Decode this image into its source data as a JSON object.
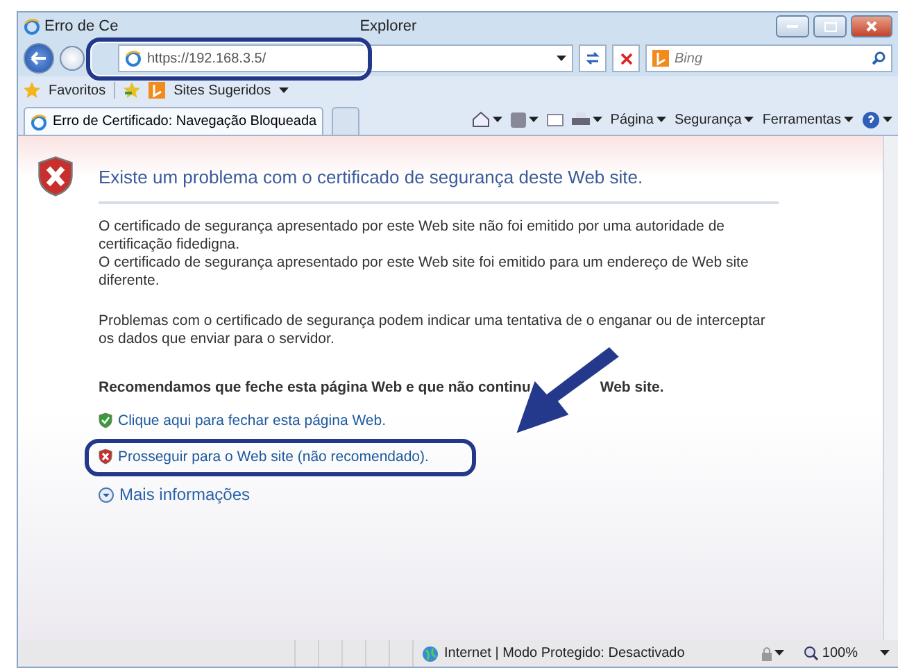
{
  "window": {
    "title_start": "Erro de Ce",
    "title_end": "Explorer"
  },
  "address_bar": {
    "url": "https://192.168.3.5/"
  },
  "search": {
    "placeholder": "Bing"
  },
  "favorites_bar": {
    "favorites": "Favoritos",
    "suggested": "Sites Sugeridos"
  },
  "tabs": [
    {
      "label": "Erro de Certificado: Navegação Bloqueada",
      "selected": true
    }
  ],
  "command_bar": [
    "Página",
    "Segurança",
    "Ferramentas"
  ],
  "content": {
    "heading": "Existe um problema com o certificado de segurança deste Web site.",
    "paragraphs": [
      "O certificado de segurança apresentado por este Web site não foi emitido por uma autoridade de certificação fidedigna.\nO certificado de segurança apresentado por este Web site foi emitido para um endereço de Web site diferente.",
      "Problemas com o certificado de segurança podem indicar uma tentativa de o enganar ou de interceptar os dados que enviar para o servidor."
    ],
    "recommendation_start": "Recomendamos que feche esta página Web e que não continu",
    "recommendation_end": "Web site.",
    "links": [
      {
        "kind": "safe",
        "text": "Clique aqui para fechar esta página Web."
      },
      {
        "kind": "unsafe",
        "text": "Prosseguir para o Web site (não recomendado)."
      }
    ],
    "more_info": "Mais informações"
  },
  "status_bar": {
    "zone": "Internet | Modo Protegido: Desactivado",
    "zoom": "100%"
  }
}
